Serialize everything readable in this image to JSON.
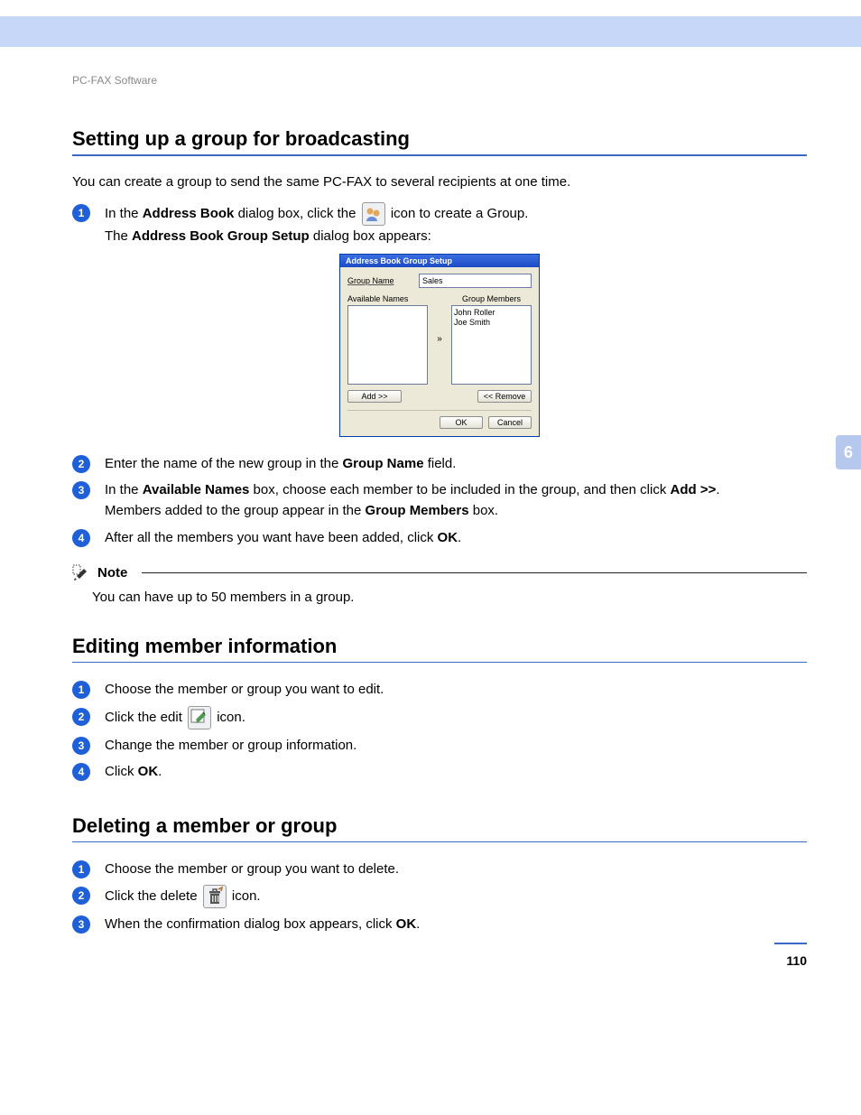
{
  "breadcrumb": "PC-FAX Software",
  "side_tab": "6",
  "page_number": "110",
  "section1": {
    "title": "Setting up a group for broadcasting",
    "intro": "You can create a group to send the same PC-FAX to several recipients at one time.",
    "steps": {
      "s1_pre": "In the ",
      "s1_b1": "Address Book",
      "s1_mid": " dialog box, click the ",
      "s1_post": " icon to create a Group.",
      "s1_line2_pre": "The ",
      "s1_line2_b": "Address Book Group Setup",
      "s1_line2_post": " dialog box appears:",
      "s2_pre": "Enter the name of the new group in the ",
      "s2_b": "Group Name",
      "s2_post": " field.",
      "s3_pre": "In the ",
      "s3_b1": "Available Names",
      "s3_mid1": " box, choose each member to be included in the group, and then click ",
      "s3_b2": "Add >>",
      "s3_end": ".",
      "s3_line2_pre": "Members added to the group appear in the ",
      "s3_line2_b": "Group Members",
      "s3_line2_post": " box.",
      "s4_pre": "After all the members you want have been added, click ",
      "s4_b": "OK",
      "s4_post": "."
    },
    "note": {
      "label": "Note",
      "body": "You can have up to 50 members in a group."
    }
  },
  "section2": {
    "title": "Editing member information",
    "steps": {
      "s1": "Choose the member or group you want to edit.",
      "s2_pre": "Click the edit ",
      "s2_post": " icon.",
      "s3": "Change the member or group information.",
      "s4_pre": "Click ",
      "s4_b": "OK",
      "s4_post": "."
    }
  },
  "section3": {
    "title": "Deleting a member or group",
    "steps": {
      "s1": "Choose the member or group you want to delete.",
      "s2_pre": "Click the delete ",
      "s2_post": " icon.",
      "s3_pre": "When the confirmation dialog box appears, click ",
      "s3_b": "OK",
      "s3_post": "."
    }
  },
  "dialog": {
    "title": "Address Book Group Setup",
    "group_name_label": "Group Name",
    "group_name_value": "Sales",
    "available_label": "Available Names",
    "members_label": "Group Members",
    "members_list": "John Roller\nJoe Smith",
    "arrow_label": "»",
    "add_btn": "Add >>",
    "remove_btn": "<< Remove",
    "ok_btn": "OK",
    "cancel_btn": "Cancel"
  }
}
